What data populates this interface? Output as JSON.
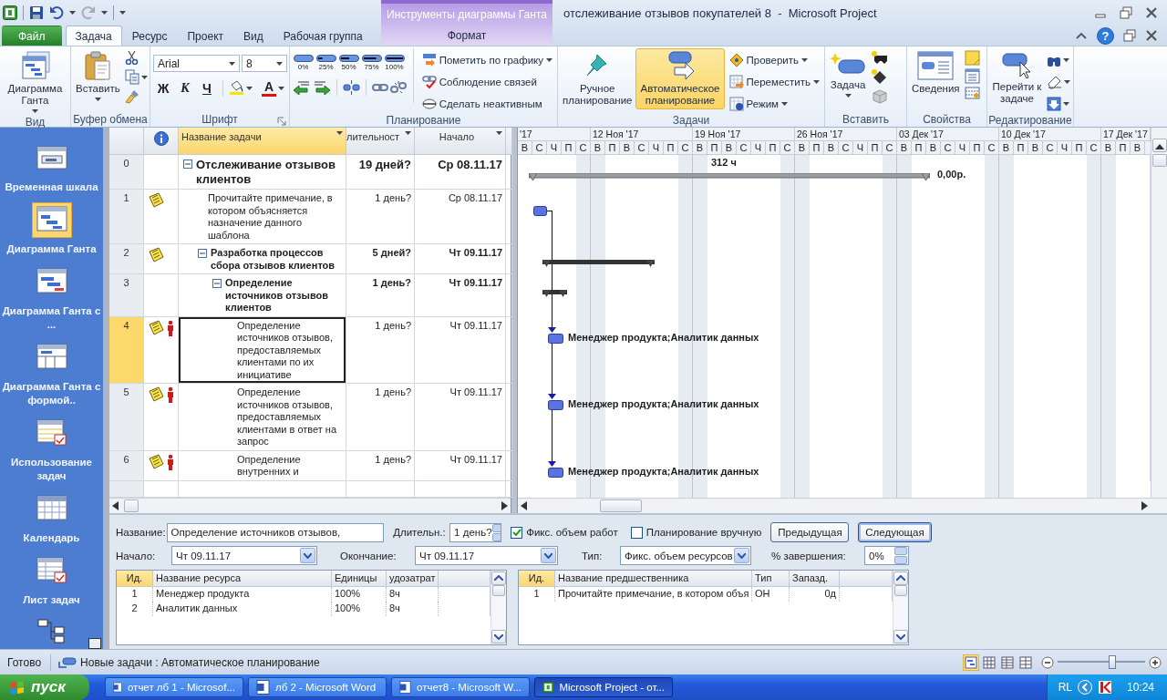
{
  "window": {
    "title": "отслеживание отзывов покупателей 8  -  Microsoft Project",
    "help": "?"
  },
  "context_tab_group": {
    "label": "Инструменты диаграммы Ганта",
    "tab": {
      "label": "Формат",
      "selected": false
    }
  },
  "tabs": [
    {
      "label": "Файл",
      "kind": "file",
      "selected": false
    },
    {
      "label": "Задача",
      "kind": "normal",
      "selected": true
    },
    {
      "label": "Ресурс",
      "kind": "normal",
      "selected": false
    },
    {
      "label": "Проект",
      "kind": "normal",
      "selected": false
    },
    {
      "label": "Вид",
      "kind": "normal",
      "selected": false
    },
    {
      "label": "Рабочая группа",
      "kind": "normal",
      "selected": false
    }
  ],
  "ribbon": {
    "view": {
      "label": "Вид",
      "button": "Диаграмма Ганта"
    },
    "clipboard": {
      "label": "Буфер обмена",
      "button": "Вставить"
    },
    "font": {
      "label": "Шрифт",
      "family": "Arial",
      "size": "8",
      "bold": "Ж",
      "italic": "К",
      "underline": "Ч",
      "font_color_button": "A"
    },
    "schedule": {
      "label": "Планирование",
      "percents": [
        "0%",
        "25%",
        "50%",
        "75%",
        "100%"
      ],
      "commands": [
        {
          "label": "Пометить по графику",
          "dropdown": true
        },
        {
          "label": "Соблюдение связей",
          "dropdown": false
        },
        {
          "label": "Сделать неактивным",
          "dropdown": false
        }
      ]
    },
    "tasks": {
      "label": "Задачи",
      "modes": [
        {
          "label": "Ручное планирование",
          "selected": false
        },
        {
          "label": "Автоматическое планирование",
          "selected": true
        }
      ],
      "commands": [
        {
          "label": "Проверить",
          "dropdown": true
        },
        {
          "label": "Переместить",
          "dropdown": true
        },
        {
          "label": "Режим",
          "dropdown": true
        }
      ]
    },
    "insert": {
      "label": "Вставить",
      "button": "Задача"
    },
    "properties": {
      "label": "Свойства",
      "button": "Сведения"
    },
    "editing": {
      "label": "Редактирование",
      "button": "Перейти к задаче"
    }
  },
  "views": [
    {
      "label": "Временная шкала",
      "selected": false
    },
    {
      "label": "Диаграмма Ганта",
      "selected": true
    },
    {
      "label": "Диаграмма Ганта с   ...",
      "selected": false
    },
    {
      "label": "Диаграмма Ганта с формой..",
      "selected": false
    },
    {
      "label": "Использование задач",
      "selected": false
    },
    {
      "label": "Календарь",
      "selected": false
    },
    {
      "label": "Лист задач",
      "selected": false
    },
    {
      "selected": false
    }
  ],
  "table": {
    "columns": [
      {
        "label": "Название задачи",
        "selected": true
      },
      {
        "label": "лительност",
        "selected": false
      },
      {
        "label": "Начало",
        "selected": false
      }
    ],
    "rows": [
      {
        "id": "0",
        "kind": "project",
        "name": "Отслеживание отзывов клиентов",
        "duration": "19 дней?",
        "start": "Ср 08.11.17",
        "notes": false,
        "resources": false,
        "selected": false,
        "expanded": true,
        "link_in": false,
        "link_out": false,
        "bar_caption": "312 ч",
        "bar_label": "0,00р.",
        "children": [
          {
            "id": "1",
            "kind": "task",
            "name": "Прочитайте примечание, в котором объясняется назначение данного шаблона",
            "duration": "1 день?",
            "start": "Ср 08.11.17",
            "notes": true,
            "resources": false,
            "selected": false,
            "link_in": false,
            "link_out": true
          },
          {
            "id": "2",
            "kind": "summary",
            "name": "Разработка процессов сбора отзывов клиентов",
            "duration": "5 дней?",
            "start": "Чт 09.11.17",
            "notes": true,
            "resources": false,
            "selected": false,
            "expanded": true,
            "link_in": false,
            "link_out": false,
            "children": [
              {
                "id": "3",
                "kind": "summary",
                "name": "Определение источников отзывов клиентов",
                "duration": "1 день?",
                "start": "Чт 09.11.17",
                "notes": false,
                "resources": false,
                "selected": false,
                "expanded": true,
                "link_in": false,
                "link_out": false,
                "children": [
                  {
                    "id": "4",
                    "kind": "task",
                    "name": "Определение источников отзывов, предоставляемых клиентами по их инициативе",
                    "duration": "1 день?",
                    "start": "Чт 09.11.17",
                    "notes": true,
                    "resources": true,
                    "selected": true,
                    "link_in": true,
                    "link_out": false,
                    "bar_label": "Менеджер продукта;Аналитик данных"
                  },
                  {
                    "id": "5",
                    "kind": "task",
                    "name": "Определение источников отзывов, предоставляемых клиентами в ответ на запрос",
                    "duration": "1 день?",
                    "start": "Чт 09.11.17",
                    "notes": true,
                    "resources": true,
                    "selected": false,
                    "link_in": true,
                    "link_out": false,
                    "bar_label": "Менеджер продукта;Аналитик данных"
                  },
                  {
                    "id": "6",
                    "kind": "task",
                    "name": "Определение внутренних и",
                    "duration": "1 день?",
                    "start": "Чт 09.11.17",
                    "notes": true,
                    "resources": true,
                    "selected": false,
                    "link_in": true,
                    "link_out": false,
                    "bar_label": "Менеджер продукта;Аналитик данных"
                  }
                ]
              }
            ]
          }
        ]
      }
    ]
  },
  "timescale": {
    "weeks": [
      {
        "label": "'17",
        "days": [
          "В",
          "С",
          "Ч",
          "П",
          "С"
        ]
      },
      {
        "label": "12 Ноя '17",
        "days": [
          "В",
          "П",
          "В",
          "С",
          "Ч",
          "П",
          "С"
        ]
      },
      {
        "label": "19 Ноя '17",
        "days": [
          "В",
          "П",
          "В",
          "С",
          "Ч",
          "П",
          "С"
        ]
      },
      {
        "label": "26 Ноя '17",
        "days": [
          "В",
          "П",
          "В",
          "С",
          "Ч",
          "П",
          "С"
        ]
      },
      {
        "label": "03 Дек '17",
        "days": [
          "В",
          "П",
          "В",
          "С",
          "Ч",
          "П",
          "С"
        ]
      },
      {
        "label": "10 Дек '17",
        "days": [
          "В",
          "П",
          "В",
          "С",
          "Ч",
          "П",
          "С"
        ]
      },
      {
        "label": "17 Дек '17",
        "days": [
          "В",
          "П",
          "В"
        ]
      }
    ]
  },
  "form": {
    "name": {
      "label": "Название:",
      "value": "Определение источников отзывов,"
    },
    "duration": {
      "label": "Длительн.:",
      "value": "1 день?"
    },
    "checks": [
      {
        "label": "Фикс. объем работ",
        "checked": true
      },
      {
        "label": "Планирование вручную",
        "checked": false
      }
    ],
    "buttons": [
      {
        "label": "Предыдущая",
        "default": false
      },
      {
        "label": "Следующая",
        "default": true
      }
    ],
    "start": {
      "label": "Начало:",
      "value": "Чт 09.11.17"
    },
    "finish": {
      "label": "Окончание:",
      "value": "Чт 09.11.17"
    },
    "type": {
      "label": "Тип:",
      "value": "Фикс. объем ресурсов"
    },
    "complete": {
      "label": "% завершения:",
      "value": "0%"
    },
    "resources": {
      "columns": [
        {
          "label": "Ид.",
          "selected": true
        },
        {
          "label": "Название ресурса",
          "selected": false
        },
        {
          "label": "Единицы",
          "selected": false
        },
        {
          "label": "удозатрат",
          "selected": false
        }
      ],
      "rows": [
        [
          "1",
          "Менеджер продукта",
          "100%",
          "8ч"
        ],
        [
          "2",
          "Аналитик данных",
          "100%",
          "8ч"
        ]
      ]
    },
    "predecessors": {
      "columns": [
        {
          "label": "Ид.",
          "selected": true
        },
        {
          "label": "Название предшественника",
          "selected": false
        },
        {
          "label": "Тип",
          "selected": false
        },
        {
          "label": "Запазд.",
          "selected": false
        }
      ],
      "rows": [
        [
          "1",
          "Прочитайте примечание, в котором объя",
          "ОН",
          "0д"
        ]
      ]
    }
  },
  "status_bar": {
    "ready": "Готово",
    "mode": "Новые задачи : Автоматическое планирование",
    "views": [
      {
        "selected": true
      },
      {
        "selected": false
      },
      {
        "selected": false
      },
      {
        "selected": false
      }
    ],
    "zoom": {
      "level": 0.63
    }
  },
  "taskbar": {
    "start": "пуск",
    "items": [
      {
        "label": "отчет лб 1 - Microsof...",
        "kind": "word",
        "selected": false
      },
      {
        "label": "лб 2 - Microsoft Word",
        "kind": "word",
        "selected": false
      },
      {
        "label": "отчет8 - Microsoft W...",
        "kind": "word",
        "selected": false
      },
      {
        "label": "Microsoft Project - от...",
        "kind": "project",
        "selected": true
      }
    ],
    "lang": "RL",
    "clock": "10:24"
  }
}
